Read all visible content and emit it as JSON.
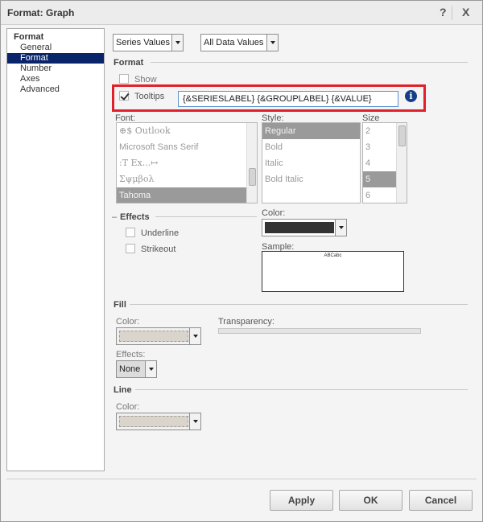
{
  "window": {
    "title": "Format: Graph",
    "help_label": "?",
    "close_label": "X"
  },
  "tree": {
    "root": "Format",
    "items": [
      {
        "label": "General",
        "selected": false
      },
      {
        "label": "Format",
        "selected": true
      },
      {
        "label": "Number",
        "selected": false
      },
      {
        "label": "Axes",
        "selected": false
      },
      {
        "label": "Advanced",
        "selected": false
      }
    ]
  },
  "top_selects": {
    "target": "Series Values",
    "scope": "All Data Values"
  },
  "format": {
    "section_title": "Format",
    "show_label": "Show",
    "show_checked": false,
    "tooltips_label": "Tooltips",
    "tooltips_checked": true,
    "tooltips_value": "{&SERIESLABEL} {&GROUPLABEL} {&VALUE}",
    "info_icon": "i",
    "highlight_color": "#e0202a"
  },
  "font": {
    "font_label": "Font:",
    "fonts": [
      "⊕$ Outlook",
      "Microsoft Sans Serif",
      ":T Ex...↦",
      "Σψμβολ",
      "Tahoma"
    ],
    "selected_font": "Tahoma",
    "style_label": "Style:",
    "styles": [
      "Regular",
      "Bold",
      "Italic",
      "Bold Italic"
    ],
    "selected_style": "Regular",
    "size_label": "Size",
    "sizes": [
      "2",
      "3",
      "4",
      "5",
      "6"
    ],
    "selected_size": "5"
  },
  "effects": {
    "section_title": "Effects",
    "underline_label": "Underline",
    "strikeout_label": "Strikeout",
    "color_label": "Color:",
    "font_color": "#333333",
    "sample_label": "Sample:",
    "sample_text": "ABCabc"
  },
  "fill": {
    "section_title": "Fill",
    "color_label": "Color:",
    "transparency_label": "Transparency:",
    "effects_label": "Effects:",
    "effects_value": "None"
  },
  "line": {
    "section_title": "Line",
    "color_label": "Color:"
  },
  "buttons": {
    "apply": "Apply",
    "ok": "OK",
    "cancel": "Cancel"
  }
}
